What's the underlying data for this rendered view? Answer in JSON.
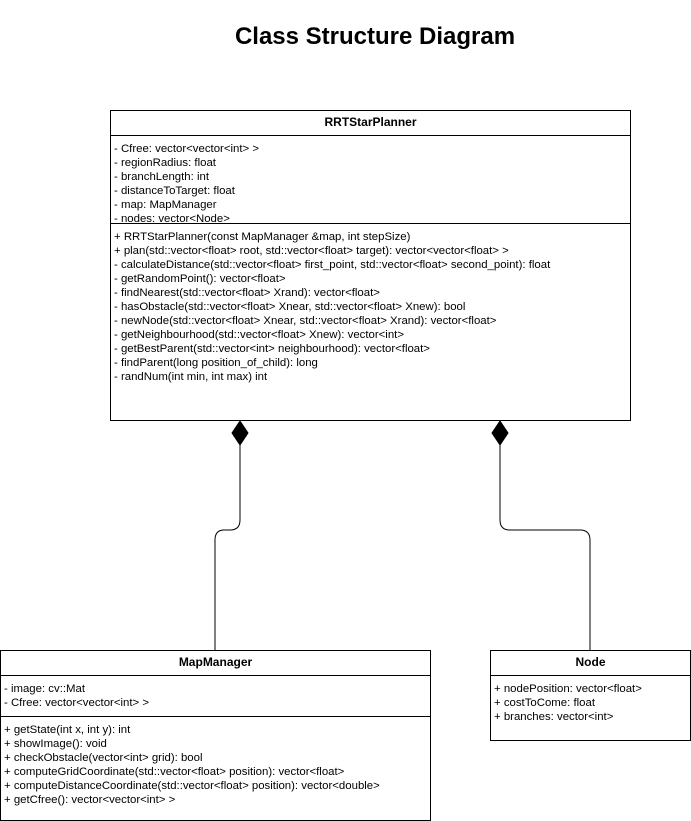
{
  "diagram": {
    "title": "Class Structure Diagram"
  },
  "classes": {
    "rrt": {
      "name": "RRTStarPlanner",
      "attributes": [
        "- Cfree: vector<vector<int> >",
        "- regionRadius: float",
        "- branchLength: int",
        "- distanceToTarget: float",
        "- map: MapManager",
        "- nodes: vector<Node>"
      ],
      "operations": [
        "+ RRTStarPlanner(const MapManager &map, int stepSize)",
        "+ plan(std::vector<float> root, std::vector<float> target): vector<vector<float> >",
        "- calculateDistance(std::vector<float> first_point, std::vector<float> second_point): float",
        "- getRandomPoint(): vector<float>",
        "- findNearest(std::vector<float> Xrand): vector<float>",
        "- hasObstacle(std::vector<float> Xnear, std::vector<float> Xnew): bool",
        "- newNode(std::vector<float> Xnear, std::vector<float> Xrand): vector<float>",
        "- getNeighbourhood(std::vector<float> Xnew): vector<int>",
        "- getBestParent(std::vector<int> neighbourhood): vector<float>",
        "- findParent(long position_of_child): long",
        "- randNum(int min, int max) int"
      ]
    },
    "map": {
      "name": "MapManager",
      "attributes": [
        "- image: cv::Mat",
        "- Cfree: vector<vector<int> >"
      ],
      "operations": [
        "+ getState(int x, int y): int",
        "+ showImage(): void",
        "+ checkObstacle(vector<int> grid): bool",
        "+ computeGridCoordinate(std::vector<float> position): vector<float>",
        "+ computeDistanceCoordinate(std::vector<float> position): vector<double>",
        "+ getCfree(): vector<vector<int> >"
      ]
    },
    "node": {
      "name": "Node",
      "attributes": [
        "+ nodePosition: vector<float>",
        "+ costToCome: float",
        "+ branches: vector<int>"
      ]
    }
  },
  "relationships": [
    {
      "type": "composition",
      "whole": "RRTStarPlanner",
      "part": "MapManager"
    },
    {
      "type": "composition",
      "whole": "RRTStarPlanner",
      "part": "Node"
    }
  ]
}
